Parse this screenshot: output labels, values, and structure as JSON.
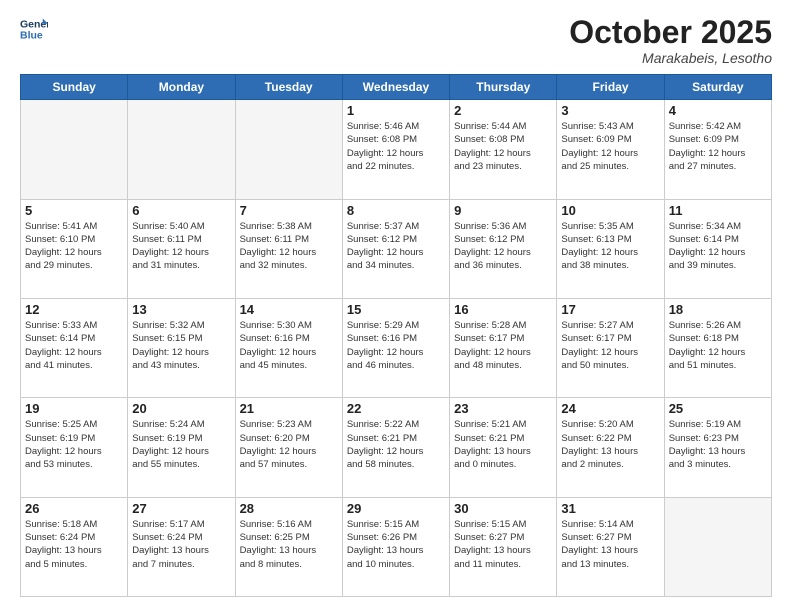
{
  "logo": {
    "line1": "General",
    "line2": "Blue"
  },
  "title": "October 2025",
  "location": "Marakabeis, Lesotho",
  "weekdays": [
    "Sunday",
    "Monday",
    "Tuesday",
    "Wednesday",
    "Thursday",
    "Friday",
    "Saturday"
  ],
  "weeks": [
    [
      {
        "day": "",
        "lines": []
      },
      {
        "day": "",
        "lines": []
      },
      {
        "day": "",
        "lines": []
      },
      {
        "day": "1",
        "lines": [
          "Sunrise: 5:46 AM",
          "Sunset: 6:08 PM",
          "Daylight: 12 hours",
          "and 22 minutes."
        ]
      },
      {
        "day": "2",
        "lines": [
          "Sunrise: 5:44 AM",
          "Sunset: 6:08 PM",
          "Daylight: 12 hours",
          "and 23 minutes."
        ]
      },
      {
        "day": "3",
        "lines": [
          "Sunrise: 5:43 AM",
          "Sunset: 6:09 PM",
          "Daylight: 12 hours",
          "and 25 minutes."
        ]
      },
      {
        "day": "4",
        "lines": [
          "Sunrise: 5:42 AM",
          "Sunset: 6:09 PM",
          "Daylight: 12 hours",
          "and 27 minutes."
        ]
      }
    ],
    [
      {
        "day": "5",
        "lines": [
          "Sunrise: 5:41 AM",
          "Sunset: 6:10 PM",
          "Daylight: 12 hours",
          "and 29 minutes."
        ]
      },
      {
        "day": "6",
        "lines": [
          "Sunrise: 5:40 AM",
          "Sunset: 6:11 PM",
          "Daylight: 12 hours",
          "and 31 minutes."
        ]
      },
      {
        "day": "7",
        "lines": [
          "Sunrise: 5:38 AM",
          "Sunset: 6:11 PM",
          "Daylight: 12 hours",
          "and 32 minutes."
        ]
      },
      {
        "day": "8",
        "lines": [
          "Sunrise: 5:37 AM",
          "Sunset: 6:12 PM",
          "Daylight: 12 hours",
          "and 34 minutes."
        ]
      },
      {
        "day": "9",
        "lines": [
          "Sunrise: 5:36 AM",
          "Sunset: 6:12 PM",
          "Daylight: 12 hours",
          "and 36 minutes."
        ]
      },
      {
        "day": "10",
        "lines": [
          "Sunrise: 5:35 AM",
          "Sunset: 6:13 PM",
          "Daylight: 12 hours",
          "and 38 minutes."
        ]
      },
      {
        "day": "11",
        "lines": [
          "Sunrise: 5:34 AM",
          "Sunset: 6:14 PM",
          "Daylight: 12 hours",
          "and 39 minutes."
        ]
      }
    ],
    [
      {
        "day": "12",
        "lines": [
          "Sunrise: 5:33 AM",
          "Sunset: 6:14 PM",
          "Daylight: 12 hours",
          "and 41 minutes."
        ]
      },
      {
        "day": "13",
        "lines": [
          "Sunrise: 5:32 AM",
          "Sunset: 6:15 PM",
          "Daylight: 12 hours",
          "and 43 minutes."
        ]
      },
      {
        "day": "14",
        "lines": [
          "Sunrise: 5:30 AM",
          "Sunset: 6:16 PM",
          "Daylight: 12 hours",
          "and 45 minutes."
        ]
      },
      {
        "day": "15",
        "lines": [
          "Sunrise: 5:29 AM",
          "Sunset: 6:16 PM",
          "Daylight: 12 hours",
          "and 46 minutes."
        ]
      },
      {
        "day": "16",
        "lines": [
          "Sunrise: 5:28 AM",
          "Sunset: 6:17 PM",
          "Daylight: 12 hours",
          "and 48 minutes."
        ]
      },
      {
        "day": "17",
        "lines": [
          "Sunrise: 5:27 AM",
          "Sunset: 6:17 PM",
          "Daylight: 12 hours",
          "and 50 minutes."
        ]
      },
      {
        "day": "18",
        "lines": [
          "Sunrise: 5:26 AM",
          "Sunset: 6:18 PM",
          "Daylight: 12 hours",
          "and 51 minutes."
        ]
      }
    ],
    [
      {
        "day": "19",
        "lines": [
          "Sunrise: 5:25 AM",
          "Sunset: 6:19 PM",
          "Daylight: 12 hours",
          "and 53 minutes."
        ]
      },
      {
        "day": "20",
        "lines": [
          "Sunrise: 5:24 AM",
          "Sunset: 6:19 PM",
          "Daylight: 12 hours",
          "and 55 minutes."
        ]
      },
      {
        "day": "21",
        "lines": [
          "Sunrise: 5:23 AM",
          "Sunset: 6:20 PM",
          "Daylight: 12 hours",
          "and 57 minutes."
        ]
      },
      {
        "day": "22",
        "lines": [
          "Sunrise: 5:22 AM",
          "Sunset: 6:21 PM",
          "Daylight: 12 hours",
          "and 58 minutes."
        ]
      },
      {
        "day": "23",
        "lines": [
          "Sunrise: 5:21 AM",
          "Sunset: 6:21 PM",
          "Daylight: 13 hours",
          "and 0 minutes."
        ]
      },
      {
        "day": "24",
        "lines": [
          "Sunrise: 5:20 AM",
          "Sunset: 6:22 PM",
          "Daylight: 13 hours",
          "and 2 minutes."
        ]
      },
      {
        "day": "25",
        "lines": [
          "Sunrise: 5:19 AM",
          "Sunset: 6:23 PM",
          "Daylight: 13 hours",
          "and 3 minutes."
        ]
      }
    ],
    [
      {
        "day": "26",
        "lines": [
          "Sunrise: 5:18 AM",
          "Sunset: 6:24 PM",
          "Daylight: 13 hours",
          "and 5 minutes."
        ]
      },
      {
        "day": "27",
        "lines": [
          "Sunrise: 5:17 AM",
          "Sunset: 6:24 PM",
          "Daylight: 13 hours",
          "and 7 minutes."
        ]
      },
      {
        "day": "28",
        "lines": [
          "Sunrise: 5:16 AM",
          "Sunset: 6:25 PM",
          "Daylight: 13 hours",
          "and 8 minutes."
        ]
      },
      {
        "day": "29",
        "lines": [
          "Sunrise: 5:15 AM",
          "Sunset: 6:26 PM",
          "Daylight: 13 hours",
          "and 10 minutes."
        ]
      },
      {
        "day": "30",
        "lines": [
          "Sunrise: 5:15 AM",
          "Sunset: 6:27 PM",
          "Daylight: 13 hours",
          "and 11 minutes."
        ]
      },
      {
        "day": "31",
        "lines": [
          "Sunrise: 5:14 AM",
          "Sunset: 6:27 PM",
          "Daylight: 13 hours",
          "and 13 minutes."
        ]
      },
      {
        "day": "",
        "lines": []
      }
    ]
  ]
}
